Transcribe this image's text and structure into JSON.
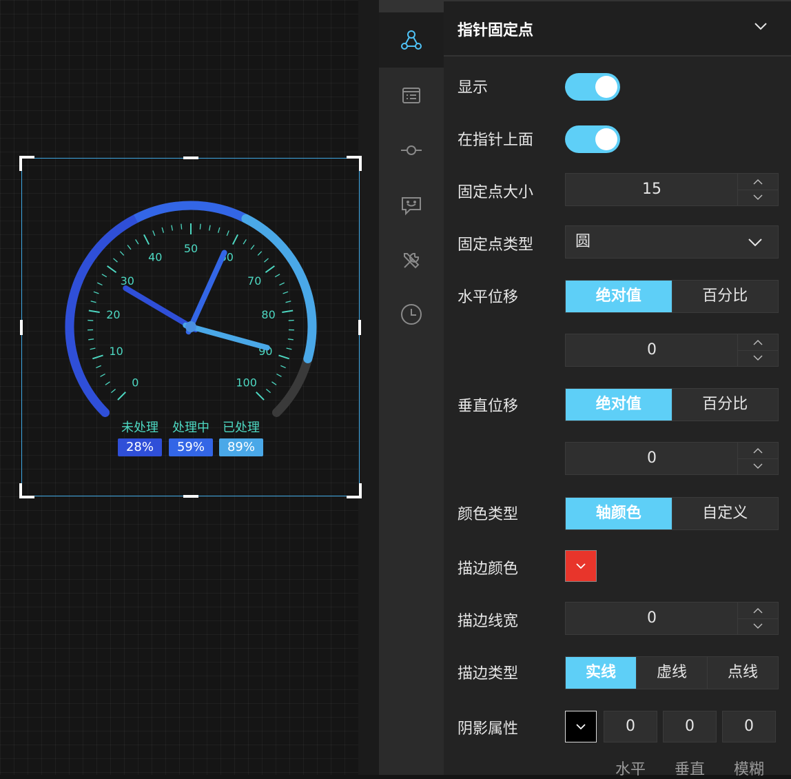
{
  "gauge": {
    "min": 0,
    "max": 100,
    "tick_labels": [
      "0",
      "10",
      "20",
      "30",
      "40",
      "50",
      "60",
      "70",
      "80",
      "90",
      "100"
    ],
    "progress_value": 89,
    "needles": [
      {
        "name": "未处理",
        "value": 28,
        "color": "#2f4fd8"
      },
      {
        "name": "处理中",
        "value": 59,
        "color": "#3366e6"
      },
      {
        "name": "已处理",
        "value": 89,
        "color": "#4aa8e8"
      }
    ],
    "legend": [
      {
        "label": "未处理",
        "value": "28%",
        "color": "#2f4fd8"
      },
      {
        "label": "处理中",
        "value": "59%",
        "color": "#3366e6"
      },
      {
        "label": "已处理",
        "value": "89%",
        "color": "#4aa8e8"
      }
    ],
    "tick_color": "#4dd8c2",
    "track_color": "#3a3a3a"
  },
  "iconbar": {
    "items": [
      "pointer-config-icon",
      "list-icon",
      "slider-icon",
      "tooltip-icon",
      "tools-icon",
      "clock-icon"
    ]
  },
  "panel": {
    "title": "指针固定点",
    "rows": {
      "show": {
        "label": "显示",
        "on": true
      },
      "on_top": {
        "label": "在指针上面",
        "on": true
      },
      "size": {
        "label": "固定点大小",
        "value": "15"
      },
      "type": {
        "label": "固定点类型",
        "value": "圆"
      },
      "h_offset": {
        "label": "水平位移",
        "options": [
          "绝对值",
          "百分比"
        ],
        "selected": 0,
        "value": "0"
      },
      "v_offset": {
        "label": "垂直位移",
        "options": [
          "绝对值",
          "百分比"
        ],
        "selected": 0,
        "value": "0"
      },
      "color_type": {
        "label": "颜色类型",
        "options": [
          "轴颜色",
          "自定义"
        ],
        "selected": 0
      },
      "stroke_color": {
        "label": "描边颜色",
        "color": "#e8352b"
      },
      "stroke_width": {
        "label": "描边线宽",
        "value": "0"
      },
      "stroke_type": {
        "label": "描边类型",
        "options": [
          "实线",
          "虚线",
          "点线"
        ],
        "selected": 0
      },
      "shadow": {
        "label": "阴影属性",
        "color": "#000000",
        "values": [
          "0",
          "0",
          "0"
        ],
        "captions": [
          "水平",
          "垂直",
          "模糊"
        ]
      }
    }
  },
  "colors": {
    "accent": "#5ecff7"
  }
}
